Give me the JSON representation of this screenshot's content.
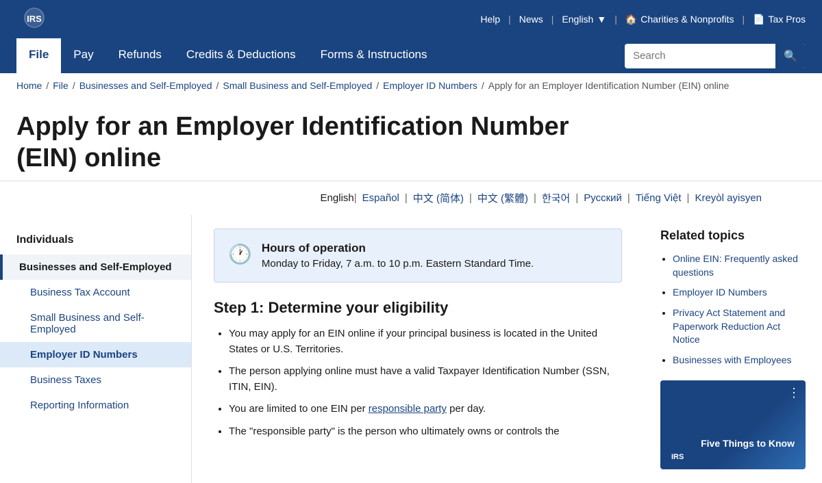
{
  "topBar": {
    "help": "Help",
    "news": "News",
    "language": "English",
    "charities": "Charities & Nonprofits",
    "taxPros": "Tax Pros"
  },
  "nav": {
    "items": [
      {
        "id": "file",
        "label": "File",
        "active": true
      },
      {
        "id": "pay",
        "label": "Pay",
        "active": false
      },
      {
        "id": "refunds",
        "label": "Refunds",
        "active": false
      },
      {
        "id": "credits",
        "label": "Credits & Deductions",
        "active": false
      },
      {
        "id": "forms",
        "label": "Forms & Instructions",
        "active": false
      }
    ],
    "searchPlaceholder": "Search"
  },
  "breadcrumb": [
    {
      "label": "Home",
      "href": "#"
    },
    {
      "label": "File",
      "href": "#"
    },
    {
      "label": "Businesses and Self-Employed",
      "href": "#"
    },
    {
      "label": "Small Business and Self-Employed",
      "href": "#"
    },
    {
      "label": "Employer ID Numbers",
      "href": "#"
    },
    {
      "label": "Apply for an Employer Identification Number (EIN) online",
      "href": null
    }
  ],
  "pageTitle": "Apply for an Employer Identification Number (EIN) online",
  "languages": [
    {
      "label": "English",
      "href": null
    },
    {
      "label": "Español",
      "href": "#"
    },
    {
      "label": "中文 (简体)",
      "href": "#"
    },
    {
      "label": "中文 (繁體)",
      "href": "#"
    },
    {
      "label": "한국어",
      "href": "#"
    },
    {
      "label": "Русский",
      "href": "#"
    },
    {
      "label": "Tiếng Việt",
      "href": "#"
    },
    {
      "label": "Kreyòl ayisyen",
      "href": "#"
    }
  ],
  "sidebar": {
    "sectionTitle": "Individuals",
    "items": [
      {
        "id": "businesses",
        "label": "Businesses and Self-Employed",
        "type": "parent"
      },
      {
        "id": "business-tax",
        "label": "Business Tax Account",
        "type": "child"
      },
      {
        "id": "small-business",
        "label": "Small Business and Self-Employed",
        "type": "child"
      },
      {
        "id": "employer-id",
        "label": "Employer ID Numbers",
        "type": "child",
        "active": true
      },
      {
        "id": "business-taxes",
        "label": "Business Taxes",
        "type": "child"
      },
      {
        "id": "reporting",
        "label": "Reporting Information",
        "type": "child"
      }
    ]
  },
  "content": {
    "hoursTitle": "Hours of operation",
    "hoursText": "Monday to Friday, 7 a.m. to 10 p.m. Eastern Standard Time.",
    "stepTitle": "Step 1: Determine your eligibility",
    "bullets": [
      "You may apply for an EIN online if your principal business is located in the United States or U.S. Territories.",
      "The person applying online must have a valid Taxpayer Identification Number (SSN, ITIN, EIN).",
      "You are limited to one EIN per responsible party per day.",
      "The \"responsible party\" is the person who ultimately owns or controls the"
    ],
    "responsiblePartyLink": "responsible party"
  },
  "related": {
    "title": "Related topics",
    "links": [
      {
        "label": "Online EIN: Frequently asked questions",
        "href": "#"
      },
      {
        "label": "Employer ID Numbers",
        "href": "#"
      },
      {
        "label": "Privacy Act Statement and Paperwork Reduction Act Notice",
        "href": "#"
      },
      {
        "label": "Businesses with Employees",
        "href": "#"
      }
    ],
    "videoText": "Five Things to Know",
    "irsLabel": "IRS"
  }
}
